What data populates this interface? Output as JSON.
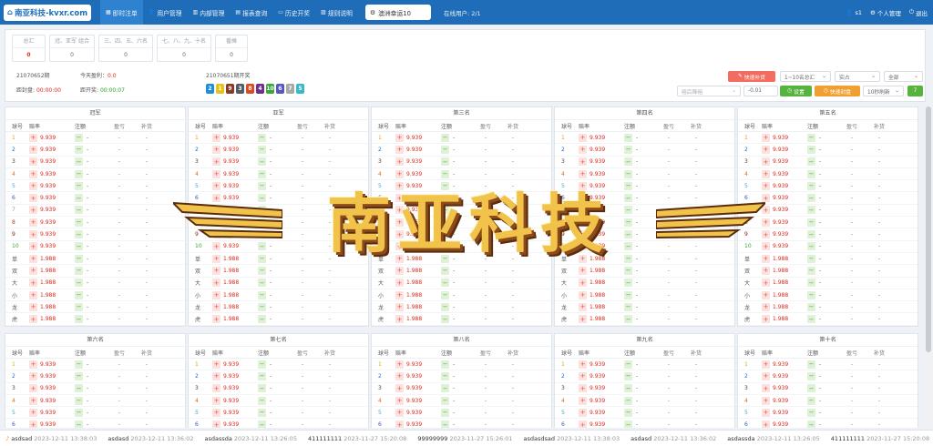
{
  "app": {
    "logo": "南亚科技-kvxr.com"
  },
  "nav": [
    {
      "label": "即时注单",
      "icon": "grid-icon",
      "active": true
    },
    {
      "label": "用户管理",
      "icon": "user-icon"
    },
    {
      "label": "内部管理",
      "icon": "book-icon"
    },
    {
      "label": "报表查询",
      "icon": "table-icon"
    },
    {
      "label": "历史开奖",
      "icon": "monitor-icon"
    },
    {
      "label": "规则说明",
      "icon": "ruler-icon"
    }
  ],
  "game": "澳洲幸运10",
  "online": "在线用户: 2/1",
  "user": {
    "name": "s1",
    "settings": "个人管理",
    "logout": "退出"
  },
  "stats": [
    {
      "label": "总汇",
      "value": "0",
      "red": true
    },
    {
      "label": "冠、亚军 组合",
      "value": "0"
    },
    {
      "label": "三、四、五、六名",
      "value": "0"
    },
    {
      "label": "七、八、九、十名",
      "value": "0"
    },
    {
      "label": "番摊",
      "value": "0"
    }
  ],
  "period": {
    "current": "21070652期",
    "today_label": "今天盈利：",
    "today_value": "0.0",
    "last": "21070651期开奖",
    "close_label": "距封盘:",
    "close_value": "00:00:00",
    "open_label": "距开奖:",
    "open_value": "00:00:07"
  },
  "result_balls": [
    {
      "n": "2",
      "color": "#1e8fd6"
    },
    {
      "n": "1",
      "color": "#e6c21a"
    },
    {
      "n": "9",
      "color": "#8a3a2a"
    },
    {
      "n": "3",
      "color": "#555b66"
    },
    {
      "n": "8",
      "color": "#e04a23"
    },
    {
      "n": "4",
      "color": "#6d2f8a"
    },
    {
      "n": "10",
      "color": "#3aa63a"
    },
    {
      "n": "6",
      "color": "#5757c0"
    },
    {
      "n": "7",
      "color": "#a8a8a8"
    },
    {
      "n": "5",
      "color": "#38b9c9"
    }
  ],
  "controls": {
    "quick_fill": "快速补货",
    "range": "1~10名总汇",
    "mode": "实占",
    "filter": "全部",
    "odds_adjust": "赔后降赔",
    "step": "-0.01",
    "settings": "设置",
    "quick_close": "快速封盘",
    "refresh": "10秒刷新",
    "count": "7"
  },
  "columns": [
    "球号",
    "赔率",
    "注额",
    "盈亏",
    "补货"
  ],
  "tables_top": [
    {
      "title": "冠军"
    },
    {
      "title": "亚军"
    },
    {
      "title": "第三名"
    },
    {
      "title": "第四名"
    },
    {
      "title": "第五名"
    }
  ],
  "tables_bottom": [
    {
      "title": "第六名"
    },
    {
      "title": "第七名"
    },
    {
      "title": "第八名"
    },
    {
      "title": "第九名"
    },
    {
      "title": "第十名"
    }
  ],
  "rows": [
    {
      "k": "1",
      "odds": "9.939",
      "c": "#e6a11a"
    },
    {
      "k": "2",
      "odds": "9.939",
      "c": "#1e6fd0"
    },
    {
      "k": "3",
      "odds": "9.939",
      "c": "#444"
    },
    {
      "k": "4",
      "odds": "9.939",
      "c": "#e06a1a"
    },
    {
      "k": "5",
      "odds": "9.939",
      "c": "#38a9d9"
    },
    {
      "k": "6",
      "odds": "9.939",
      "c": "#3a5ab0"
    },
    {
      "k": "7",
      "odds": "9.939",
      "c": "#999"
    },
    {
      "k": "8",
      "odds": "9.939",
      "c": "#c0392b"
    },
    {
      "k": "9",
      "odds": "9.939",
      "c": "#7a2a1a"
    },
    {
      "k": "10",
      "odds": "9.939",
      "c": "#3aa63a"
    },
    {
      "k": "单",
      "odds": "1.988",
      "c": "#555"
    },
    {
      "k": "双",
      "odds": "1.988",
      "c": "#555"
    },
    {
      "k": "大",
      "odds": "1.988",
      "c": "#555"
    },
    {
      "k": "小",
      "odds": "1.988",
      "c": "#555"
    },
    {
      "k": "龙",
      "odds": "1.988",
      "c": "#555"
    },
    {
      "k": "虎",
      "odds": "1.988",
      "c": "#555"
    }
  ],
  "cell_empty": "-",
  "watermark": "南亚科技",
  "ticker": [
    {
      "name": "asdsad",
      "time": "2023-12-11 13:38:03"
    },
    {
      "name": "asdasd",
      "time": "2023-12-11 13:36:02"
    },
    {
      "name": "asdassda",
      "time": "2023-12-11 13:26:05"
    },
    {
      "name": "411111111",
      "time": "2023-11-27 15:20:08"
    },
    {
      "name": "99999999",
      "time": "2023-11-27 15:26:01"
    },
    {
      "name": "asdasdsad",
      "time": "2023-12-11 13:38:03"
    },
    {
      "name": "asdasd",
      "time": "2023-12-11 13:36:02"
    },
    {
      "name": "asdassda",
      "time": "2023-12-11 13:26:05"
    },
    {
      "name": "411111111",
      "time": "2023-11-27 15:20:08"
    }
  ]
}
